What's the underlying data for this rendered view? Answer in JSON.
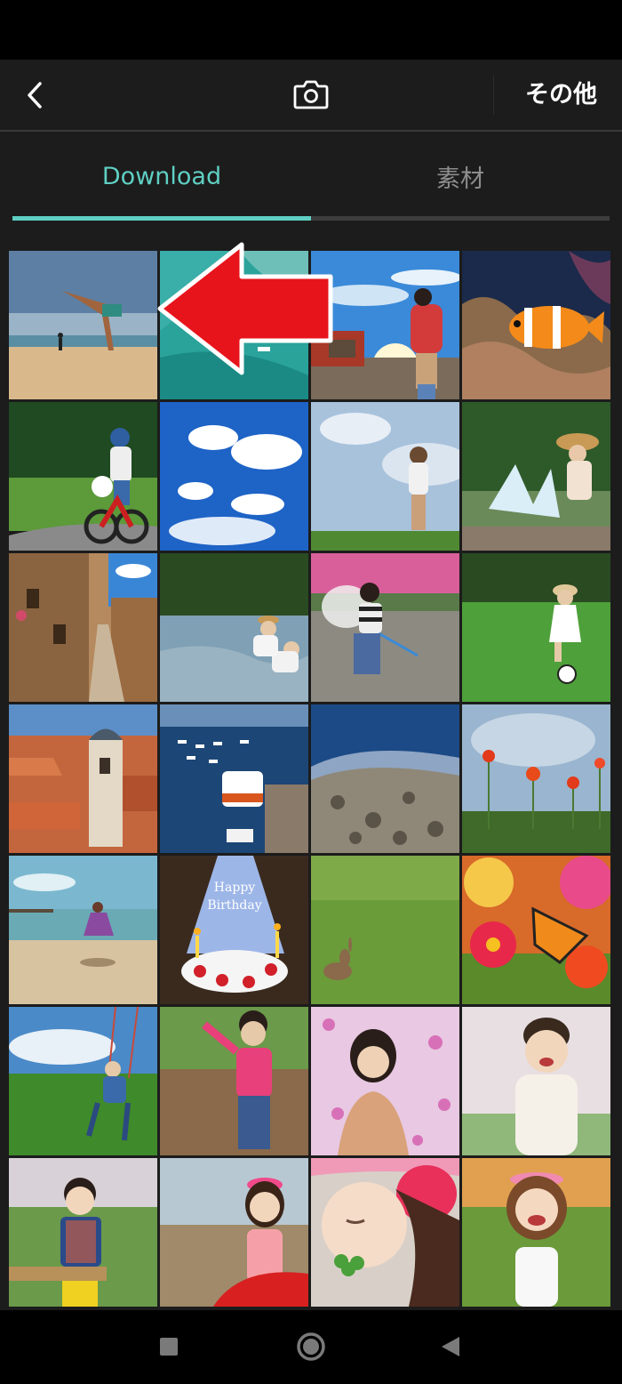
{
  "header": {
    "back_icon": "chevron-left-icon",
    "camera_icon": "camera-icon",
    "more_label": "その他"
  },
  "tabs": [
    {
      "label": "Download",
      "active": true
    },
    {
      "label": "素材",
      "active": false
    }
  ],
  "accent_color": "#5fcfc3",
  "photos": [
    {
      "subject": "man doing handstand on beach"
    },
    {
      "subject": "aerial view of turquoise sea"
    },
    {
      "subject": "child with red backpack at railway"
    },
    {
      "subject": "clownfish and coral"
    },
    {
      "subject": "child riding red bicycle"
    },
    {
      "subject": "blue sky with white clouds"
    },
    {
      "subject": "child with camera in field"
    },
    {
      "subject": "girl splashing in fountain"
    },
    {
      "subject": "old stone alley with flowers"
    },
    {
      "subject": "woman and child at river"
    },
    {
      "subject": "boy with butterfly net"
    },
    {
      "subject": "girl kicking soccer ball"
    },
    {
      "subject": "red-roofed old town with bell tower"
    },
    {
      "subject": "harbor with ferry boat"
    },
    {
      "subject": "rocky coast from above"
    },
    {
      "subject": "red poppies in meadow"
    },
    {
      "subject": "child jumping on beach"
    },
    {
      "subject": "birthday cake with candles"
    },
    {
      "subject": "rabbit on grass"
    },
    {
      "subject": "butterfly on red flower"
    },
    {
      "subject": "child on swing"
    },
    {
      "subject": "boy in pink shirt in sand"
    },
    {
      "subject": "woman in cosmos flower field"
    },
    {
      "subject": "toddler holding flower"
    },
    {
      "subject": "toddler at picnic table"
    },
    {
      "subject": "girl with flower crown"
    },
    {
      "subject": "girl smelling clover"
    },
    {
      "subject": "laughing girl with flower crown"
    }
  ],
  "annotation": {
    "type": "left-arrow",
    "color": "#e8141c"
  },
  "nav": [
    "recent-apps-icon",
    "home-icon",
    "back-triangle-icon"
  ]
}
